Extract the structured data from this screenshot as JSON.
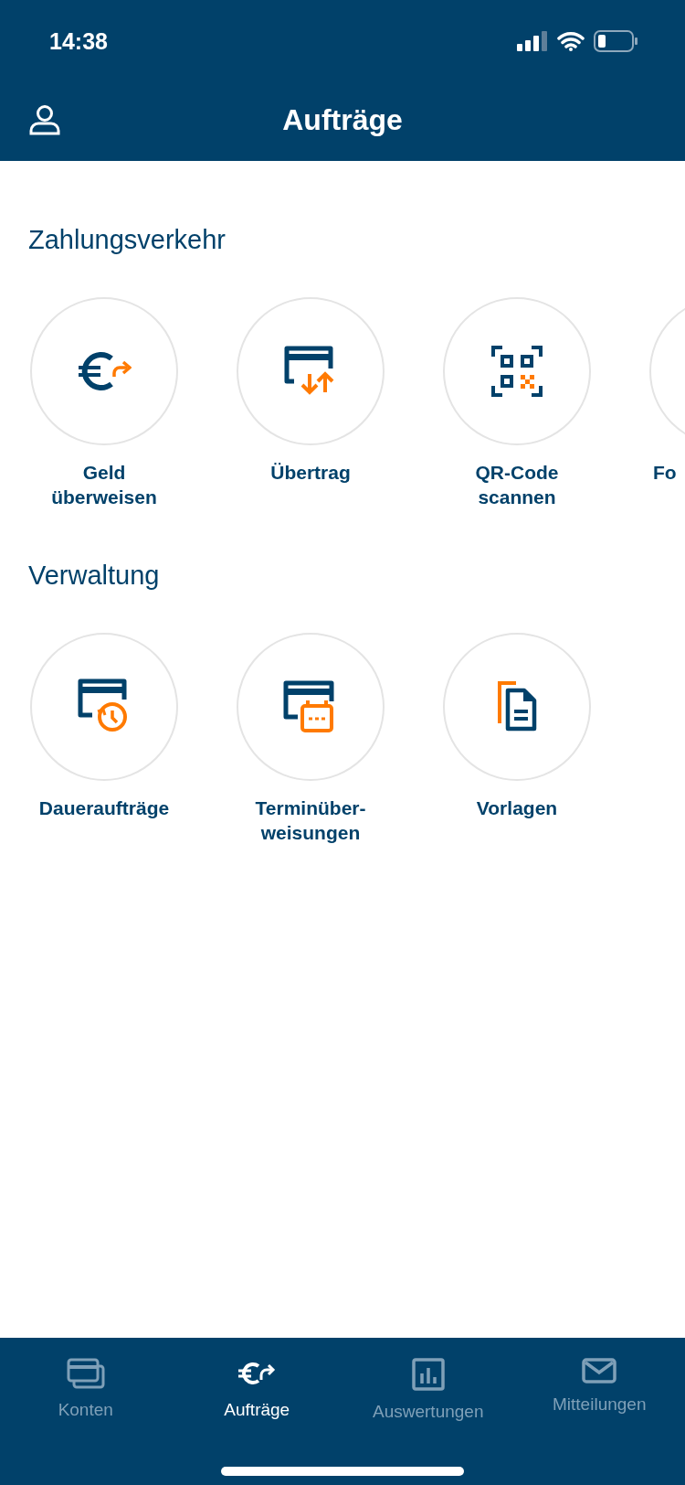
{
  "status_bar": {
    "time": "14:38"
  },
  "nav": {
    "title": "Aufträge"
  },
  "sections": [
    {
      "title": "Zahlungsverkehr",
      "items": [
        {
          "kind": "euro-send",
          "label": "Geld überweisen",
          "cut": false
        },
        {
          "kind": "card-transfer",
          "label": "Übertrag",
          "cut": false
        },
        {
          "kind": "qr",
          "label": "QR-Code scannen",
          "cut": false
        },
        {
          "kind": "blank",
          "label": "Fo",
          "cut": true
        }
      ]
    },
    {
      "title": "Verwaltung",
      "items": [
        {
          "kind": "card-clock",
          "label": "Daueraufträge",
          "cut": false
        },
        {
          "kind": "card-calendar",
          "label": "Terminüber-weisungen",
          "cut": false
        },
        {
          "kind": "documents",
          "label": "Vorlagen",
          "cut": false
        }
      ]
    }
  ],
  "tab_bar": [
    {
      "kind": "cards",
      "label": "Konten",
      "selected": false
    },
    {
      "kind": "euro",
      "label": "Aufträge",
      "selected": true
    },
    {
      "kind": "chart",
      "label": "Auswertungen",
      "selected": false
    },
    {
      "kind": "mail",
      "label": "Mitteilungen",
      "selected": false
    }
  ]
}
